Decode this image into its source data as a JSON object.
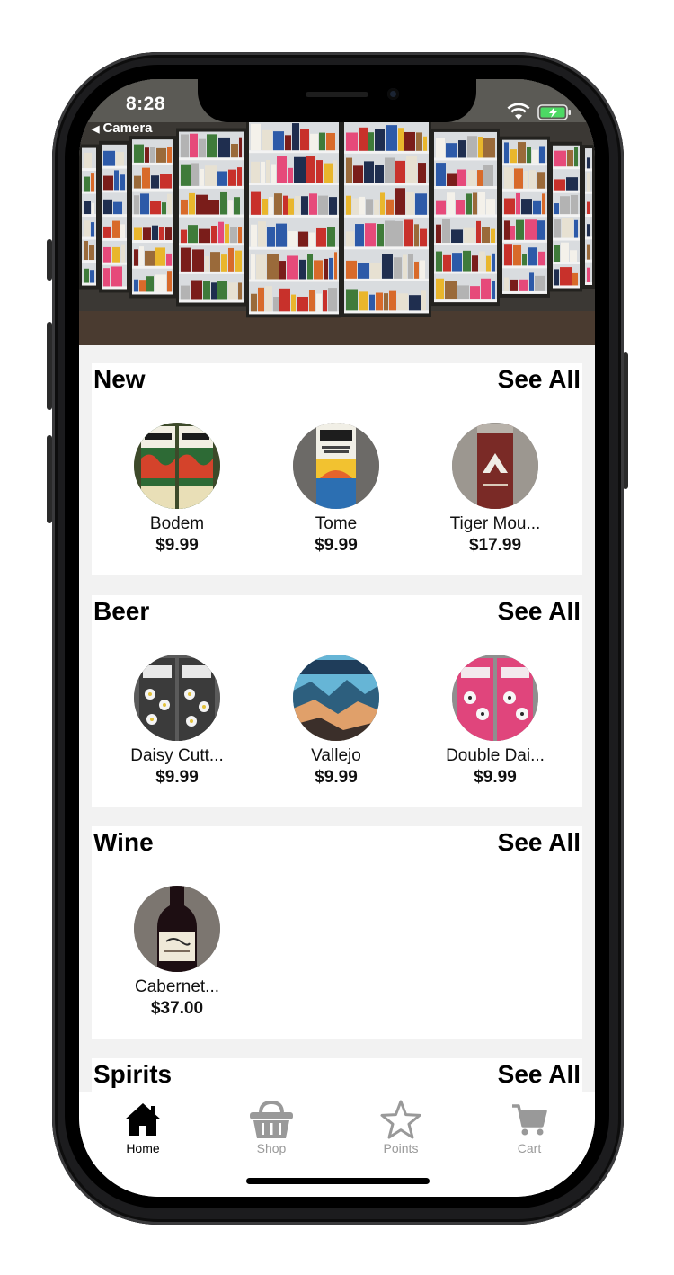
{
  "status_bar": {
    "time": "8:28",
    "back_app": "Camera",
    "back_glyph": "◀",
    "icons": [
      "wifi-icon",
      "battery-charging-icon"
    ]
  },
  "hero": {
    "image": "store-cooler-panorama"
  },
  "sections": [
    {
      "title": "New",
      "see_all": "See All",
      "products": [
        {
          "name": "Bodem",
          "price": "$9.99"
        },
        {
          "name": "Tome",
          "price": "$9.99"
        },
        {
          "name": "Tiger Mou...",
          "price": "$17.99"
        }
      ]
    },
    {
      "title": "Beer",
      "see_all": "See All",
      "products": [
        {
          "name": "Daisy Cutt...",
          "price": "$9.99"
        },
        {
          "name": "Vallejo",
          "price": "$9.99"
        },
        {
          "name": "Double Dai...",
          "price": "$9.99"
        }
      ]
    },
    {
      "title": "Wine",
      "see_all": "See All",
      "products": [
        {
          "name": "Cabernet...",
          "price": "$37.00"
        }
      ]
    },
    {
      "title": "Spirits",
      "see_all": "See All",
      "products": []
    }
  ],
  "tabs": [
    {
      "label": "Home",
      "icon": "home-icon",
      "active": true
    },
    {
      "label": "Shop",
      "icon": "basket-icon",
      "active": false
    },
    {
      "label": "Points",
      "icon": "star-icon",
      "active": false
    },
    {
      "label": "Cart",
      "icon": "cart-icon",
      "active": false
    }
  ],
  "colors": {
    "active_tab": "#000000",
    "inactive_tab": "#9a9a9a",
    "section_bg": "#ffffff",
    "content_bg": "#f2f2f2"
  }
}
